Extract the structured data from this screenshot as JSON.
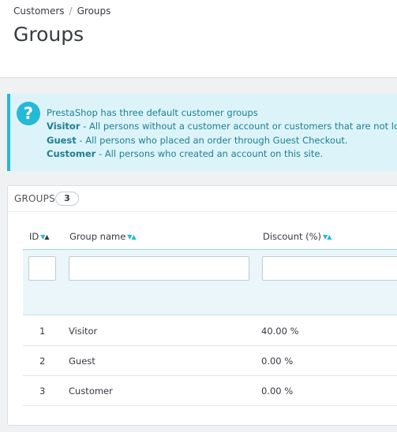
{
  "breadcrumb": {
    "items": [
      "Customers",
      "Groups"
    ],
    "separator": "/"
  },
  "page_title": "Groups",
  "info": {
    "icon": "question-icon",
    "intro": "PrestaShop has three default customer groups",
    "lines": [
      {
        "term": "Visitor",
        "text": " - All persons without a customer account or customers that are not logge"
      },
      {
        "term": "Guest",
        "text": " - All persons who placed an order through Guest Checkout."
      },
      {
        "term": "Customer",
        "text": " - All persons who created an account on this site."
      }
    ]
  },
  "panel": {
    "title": "GROUPS",
    "count": "3"
  },
  "table": {
    "columns": [
      {
        "label": "ID",
        "sort": "asc"
      },
      {
        "label": "Group name",
        "sort": "none"
      },
      {
        "label": "Discount (%)",
        "sort": "none"
      }
    ],
    "rows": [
      {
        "id": "1",
        "name": "Visitor",
        "discount": "40.00 %"
      },
      {
        "id": "2",
        "name": "Guest",
        "discount": "0.00 %"
      },
      {
        "id": "3",
        "name": "Customer",
        "discount": "0.00 %"
      }
    ]
  },
  "colors": {
    "accent": "#25b9d7",
    "info_bg": "#dcf4f9",
    "filter_bg": "#eaf6fa"
  }
}
